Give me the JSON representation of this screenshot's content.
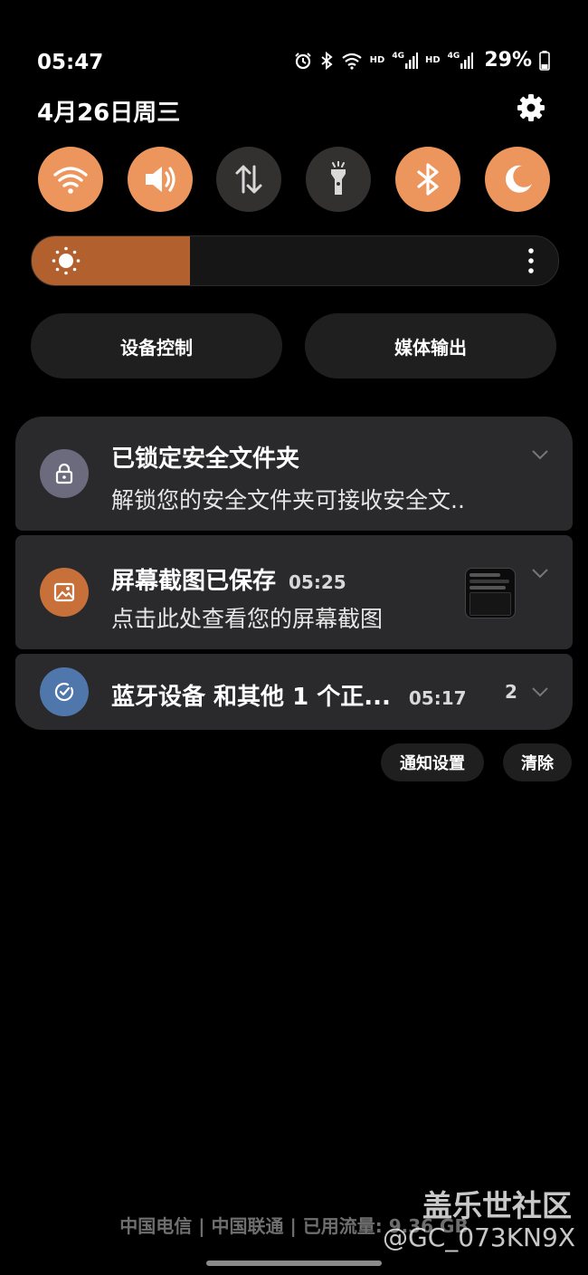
{
  "status_bar": {
    "time": "05:47",
    "hd1": "HD",
    "net1": "4G",
    "hd2": "HD",
    "net2": "4G",
    "battery": "29%",
    "icons": [
      "alarm-icon",
      "bluetooth-icon",
      "wifi-icon",
      "signal-icon",
      "signal-icon",
      "battery-icon"
    ]
  },
  "header": {
    "date": "4月26日周三",
    "settings_icon": "gear-icon"
  },
  "quick_toggles": [
    {
      "name": "wifi",
      "icon": "wifi-icon",
      "active": true
    },
    {
      "name": "sound",
      "icon": "volume-icon",
      "active": true
    },
    {
      "name": "mobile-data",
      "icon": "data-transfer-icon",
      "active": false
    },
    {
      "name": "flashlight",
      "icon": "flashlight-icon",
      "active": false
    },
    {
      "name": "bluetooth",
      "icon": "bluetooth-icon",
      "active": true
    },
    {
      "name": "night-mode",
      "icon": "moon-icon",
      "active": true
    }
  ],
  "brightness": {
    "level": 0.3
  },
  "buttons": {
    "device_control": "设备控制",
    "media_output": "媒体输出"
  },
  "notifications": [
    {
      "title": "已锁定安全文件夹",
      "text": "解锁您的安全文件夹可接收安全文..",
      "icon": "lock-icon"
    },
    {
      "title": "屏幕截图已保存",
      "time": "05:25",
      "text": "点击此处查看您的屏幕截图",
      "icon": "image-icon"
    },
    {
      "title": "蓝牙设备 和其他 1 个正...",
      "time": "05:17",
      "count": "2",
      "icon": "check-circle-icon"
    }
  ],
  "actions": {
    "notification_settings": "通知设置",
    "clear": "清除"
  },
  "footer": {
    "carrier_info": "中国电信 | 中国联通 | 已用流量: 9.36 GB",
    "watermark_1": "盖乐世社区",
    "watermark_2": "@GC_073KN9X"
  },
  "colors": {
    "accent": "#ec955d",
    "brightness_fill": "#b1602e",
    "card": "#2a2a2c"
  }
}
